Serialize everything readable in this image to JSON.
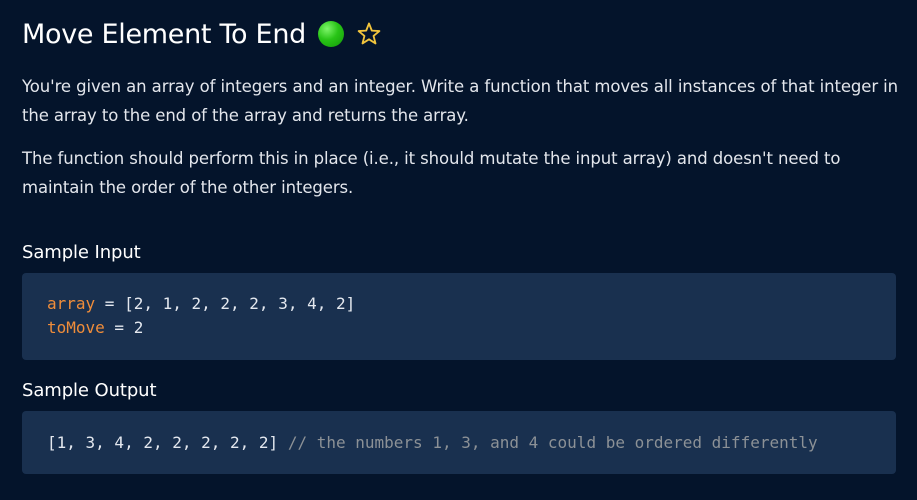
{
  "problem": {
    "title": "Move Element To End",
    "difficulty_color": "#28c416",
    "difficulty_icon": "green-circle-icon",
    "favorite_icon": "star-outline-icon",
    "star_color": "#f2c53d",
    "description_1": "You're given an array of integers and an integer. Write a function that moves all instances of that integer in the array to the end of the array and returns the array.",
    "description_2": "The function should perform this in place (i.e., it should mutate the input array) and doesn't need to maintain the order of the other integers."
  },
  "sample_input": {
    "heading": "Sample Input",
    "lines": [
      {
        "var": "array",
        "rest": " = [2, 1, 2, 2, 2, 3, 4, 2]"
      },
      {
        "var": "toMove",
        "rest": " = 2"
      }
    ]
  },
  "sample_output": {
    "heading": "Sample Output",
    "value": "[1, 3, 4, 2, 2, 2, 2, 2]",
    "comment": " // the numbers 1, 3, and 4 could be ordered differently"
  },
  "colors": {
    "background": "#04142b",
    "code_background": "#19304f",
    "variable": "#f08d3a",
    "comment": "#8c9196"
  }
}
